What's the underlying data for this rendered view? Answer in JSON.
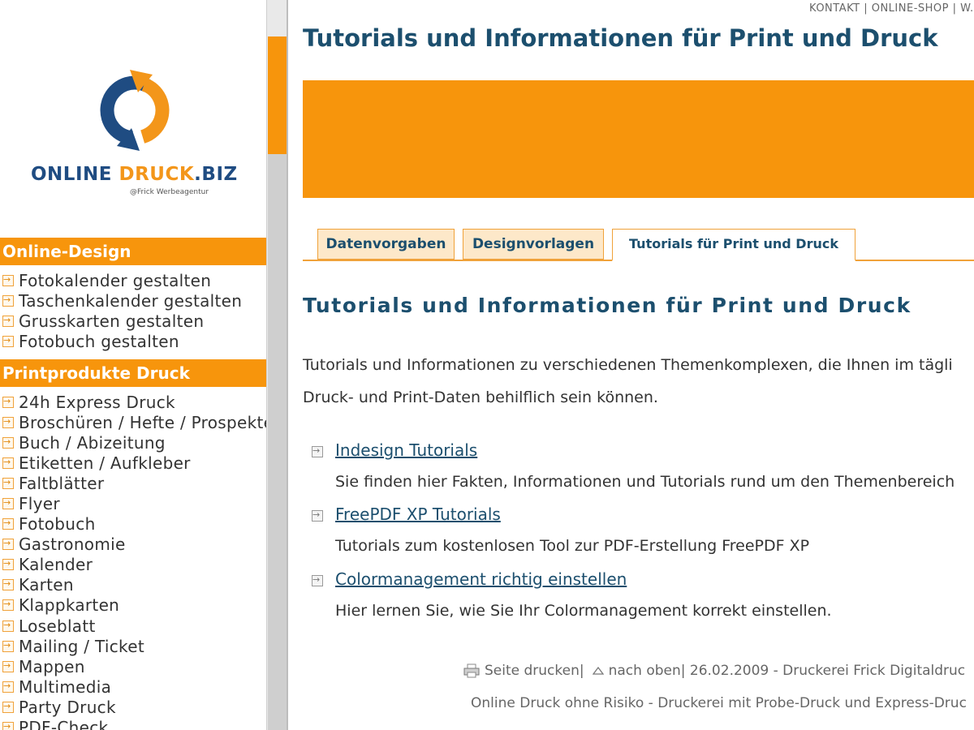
{
  "colors": {
    "orange": "#f7950c",
    "dark_blue": "#1c4f6e",
    "logo_blue": "#1f4c82"
  },
  "logo": {
    "part1": "ONLINE ",
    "part2": "DRUCK",
    "part3": ".BIZ",
    "subtitle": "@Frick Werbeagentur"
  },
  "topnav": {
    "kontakt": "KONTAKT",
    "sep1": " | ",
    "shop": "ONLINE-SHOP",
    "sep2": " | ",
    "more": "W..."
  },
  "page_title": "Tutorials und Informationen für Print und Druck",
  "sidebar": {
    "online_design": {
      "title": "Online-Design",
      "items": [
        "Fotokalender gestalten",
        "Taschenkalender gestalten",
        "Grusskarten gestalten",
        "Fotobuch gestalten"
      ]
    },
    "printprodukte": {
      "title": "Printprodukte Druck",
      "items": [
        "24h Express Druck",
        "Broschüren / Hefte / Prospekte",
        "Buch / Abizeitung",
        "Etiketten / Aufkleber",
        "Faltblätter",
        "Flyer",
        "Fotobuch",
        "Gastronomie",
        "Kalender",
        "Karten",
        "Klappkarten",
        "Loseblatt",
        "Mailing / Ticket",
        "Mappen",
        "Multimedia",
        "Party Druck",
        "PDF-Check"
      ]
    }
  },
  "tabs": [
    "Datenvorgaben",
    "Designvorlagen",
    "Tutorials für Print und Druck"
  ],
  "content": {
    "heading": "Tutorials und Informationen für Print und Druck",
    "intro_line1": "Tutorials und Informationen zu verschiedenen Themenkomplexen, die Ihnen im tägli",
    "intro_line2": "Druck- und Print-Daten behilflich sein können.",
    "tutorials": [
      {
        "title": "Indesign Tutorials",
        "desc": "Sie finden hier Fakten, Informationen und Tutorials rund um den Themenbereich"
      },
      {
        "title": "FreePDF XP Tutorials",
        "desc": "Tutorials zum kostenlosen Tool zur PDF-Erstellung FreePDF XP"
      },
      {
        "title": "Colormanagement richtig einstellen",
        "desc": "Hier lernen Sie, wie Sie Ihr Colormanagement korrekt einstellen."
      }
    ]
  },
  "footer": {
    "print": "Seite drucken",
    "sep": " | ",
    "top": "nach oben",
    "info": " | 26.02.2009 - Druckerei Frick Digitaldruc",
    "line2": "Online Druck ohne Risiko - Druckerei mit Probe-Druck und Express-Druc"
  }
}
